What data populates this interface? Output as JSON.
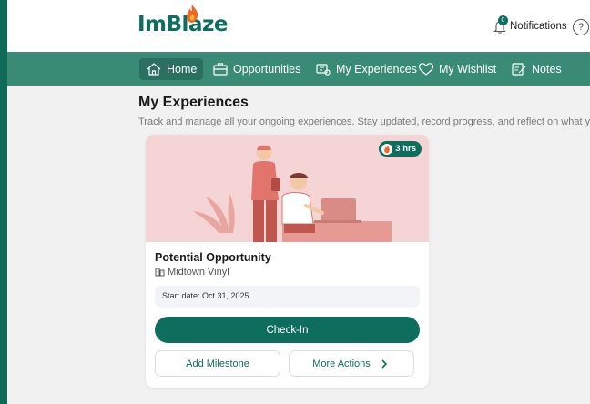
{
  "brand": {
    "name_a": "ImBl",
    "name_b": "aze"
  },
  "header": {
    "notifications_label": "Notifications",
    "notifications_count": "0",
    "help_glyph": "?"
  },
  "nav": {
    "items": [
      {
        "label": "Home",
        "icon": "home-icon",
        "active": true
      },
      {
        "label": "Opportunities",
        "icon": "briefcase-icon"
      },
      {
        "label": "My Experiences",
        "icon": "experiences-icon"
      },
      {
        "label": "My Wishlist",
        "icon": "heart-icon"
      },
      {
        "label": "Notes",
        "icon": "notes-icon"
      }
    ]
  },
  "page": {
    "title": "My Experiences",
    "subtitle": "Track and manage all your ongoing experiences. Stay updated, record progress, and reflect on what you've a"
  },
  "card": {
    "hours": "3 hrs",
    "title": "Potential Opportunity",
    "company": "Midtown Vinyl",
    "start_date": "Start date: Oct 31, 2025",
    "checkin_label": "Check-In",
    "add_milestone_label": "Add Milestone",
    "more_actions_label": "More Actions"
  },
  "colors": {
    "brand_green": "#0e6e5d",
    "nav_green": "#3a8b76",
    "card_image_pink": "#f4d4d4",
    "flame_orange": "#f26522"
  }
}
